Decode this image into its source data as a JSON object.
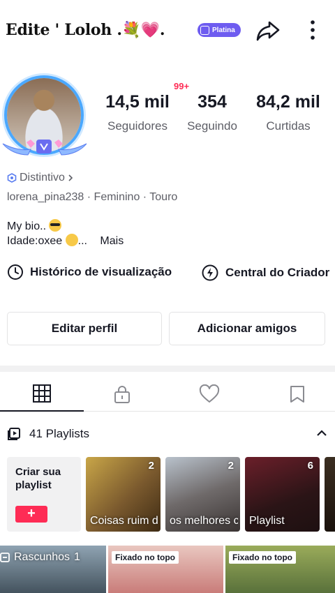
{
  "header": {
    "username": "Edite ' Loloh .💐💗.",
    "badge_label": "Platina"
  },
  "profile": {
    "notification_count": "99+",
    "stats": {
      "followers_value": "14,5 mil",
      "followers_label": "Seguidores",
      "following_value": "354",
      "following_label": "Seguindo",
      "likes_value": "84,2 mil",
      "likes_label": "Curtidas"
    },
    "badge_link": "Distintivo",
    "meta": "lorena_pina238 · Feminino · Touro",
    "bio_line1": "My bio..",
    "bio_line2": "Idade:oxee",
    "bio_more": "Mais"
  },
  "links": {
    "history": "Histórico de visualização",
    "creator_center": "Central do Criador"
  },
  "buttons": {
    "edit_profile": "Editar perfil",
    "add_friends": "Adicionar amigos"
  },
  "tabs": [
    {
      "icon": "grid-icon"
    },
    {
      "icon": "lock-icon"
    },
    {
      "icon": "heart-icon"
    },
    {
      "icon": "bookmark-icon"
    }
  ],
  "playlists": {
    "header": "41 Playlists",
    "create_label": "Criar sua playlist",
    "create_button": "+",
    "items": [
      {
        "name": "Coisas ruim de ser eu",
        "count": "2"
      },
      {
        "name": "os melhores ca...",
        "count": "2"
      },
      {
        "name": "Playlist",
        "count": "6"
      }
    ]
  },
  "videos": {
    "drafts_label": "Rascunhos",
    "drafts_count": "1",
    "pinned_label": "Fixado no topo"
  },
  "colors": {
    "accent_red": "#fe2c55",
    "badge_purple": "#6e5cf0",
    "secondary_text": "#5d5e66"
  }
}
